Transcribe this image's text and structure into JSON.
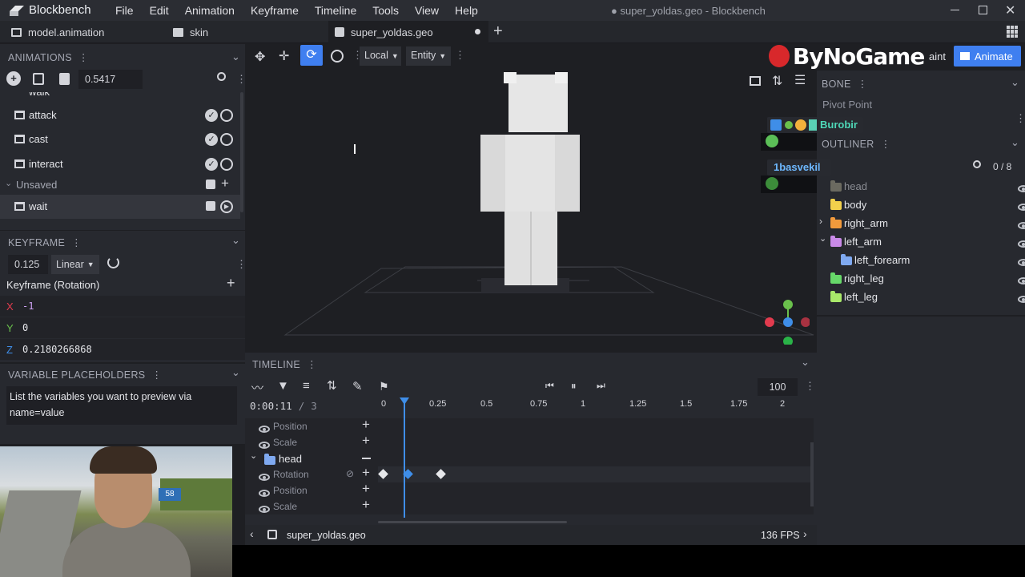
{
  "app": {
    "name": "Blockbench",
    "window_title": "● super_yoldas.geo - Blockbench"
  },
  "menu": [
    "File",
    "Edit",
    "Animation",
    "Keyframe",
    "Timeline",
    "Tools",
    "View",
    "Help"
  ],
  "tabs": [
    {
      "label": "model.animation"
    },
    {
      "label": "skin"
    },
    {
      "label": "super_yoldas.geo"
    }
  ],
  "toolbar": {
    "space": "Local",
    "pivot": "Entity"
  },
  "modes": {
    "paint": "aint",
    "animate": "Animate"
  },
  "watermark": "ByNoGame",
  "animations": {
    "title": "ANIMATIONS",
    "length_value": "0.5417",
    "partial_item": "walk",
    "items": [
      "attack",
      "cast",
      "interact"
    ],
    "unsaved_label": "Unsaved",
    "selected": "wait"
  },
  "keyframe": {
    "title": "KEYFRAME",
    "time": "0.125",
    "interpolation": "Linear",
    "channel": "Keyframe (Rotation)",
    "x": "-1",
    "y": "0",
    "z": "0.2180266868",
    "x_label": "X",
    "y_label": "Y",
    "z_label": "Z"
  },
  "variables": {
    "title": "VARIABLE PLACEHOLDERS",
    "text": "List the variables you want to preview via name=value"
  },
  "bone": {
    "title": "BONE",
    "pivot": "Pivot Point"
  },
  "outliner": {
    "title": "OUTLINER",
    "count": "0 / 8",
    "items": [
      "head",
      "body",
      "right_arm",
      "left_arm",
      "left_forearm",
      "right_leg",
      "left_leg"
    ]
  },
  "chat": {
    "user1": "Burobir",
    "user2": "1basvekil"
  },
  "timeline": {
    "title": "TIMELINE",
    "time": "0:00:11",
    "separator": "/",
    "fps_count": "3",
    "zoom": "100",
    "ruler": [
      "0",
      "0.25",
      "0.5",
      "0.75",
      "1",
      "1.25",
      "1.5",
      "1.75",
      "2"
    ],
    "rows": [
      "Position",
      "Scale",
      "head",
      "Rotation",
      "Position",
      "Scale"
    ],
    "file": "super_yoldas.geo",
    "fps": "136 FPS"
  },
  "colors": {
    "accent": "#3f7ff0",
    "x": "#e23b4e",
    "y": "#6ac04c",
    "z": "#3f8ee8"
  }
}
